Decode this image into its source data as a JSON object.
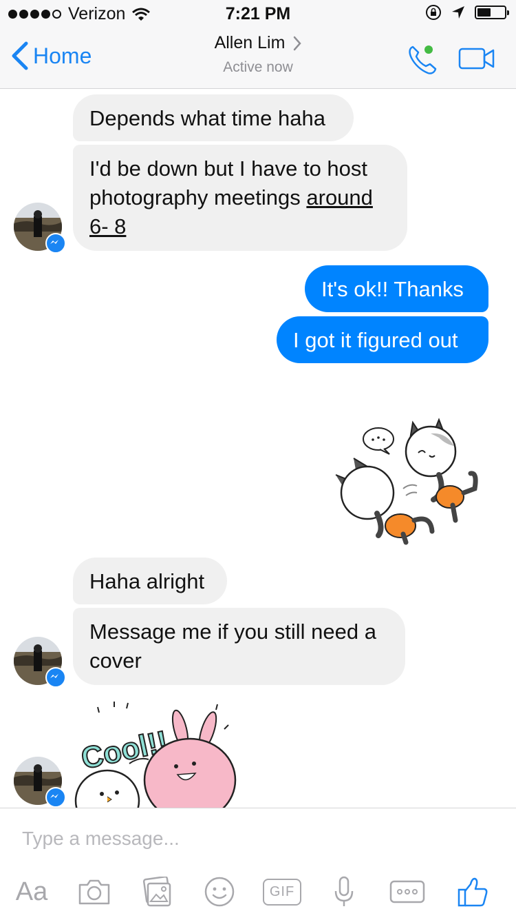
{
  "status_bar": {
    "carrier": "Verizon",
    "time": "7:21 PM",
    "signal_bars_filled": 4,
    "signal_bars_total": 5,
    "battery_level": 0.5,
    "icons": [
      "wifi-icon",
      "orientation-lock-icon",
      "location-arrow-icon",
      "battery-icon"
    ]
  },
  "header": {
    "back_label": "Home",
    "contact_name": "Allen Lim",
    "status": "Active now",
    "icons": [
      "back-chevron-icon",
      "chevron-right-icon",
      "phone-call-icon",
      "video-call-icon"
    ]
  },
  "messages": [
    {
      "direction": "incoming",
      "text": "Depends what time haha"
    },
    {
      "direction": "incoming",
      "parts": [
        "I'd be down but I have to host photography meetings ",
        "around 6- 8"
      ]
    },
    {
      "direction": "outgoing",
      "text": "It's ok!! Thanks"
    },
    {
      "direction": "outgoing",
      "text": "I got it figured out"
    },
    {
      "direction": "outgoing",
      "type": "sticker",
      "sticker": "two-cats-sticker"
    },
    {
      "direction": "incoming",
      "text": "Haha alright"
    },
    {
      "direction": "incoming",
      "text": "Message me if you still need a cover"
    },
    {
      "direction": "incoming",
      "type": "sticker",
      "sticker": "cool-bunny-sticker",
      "sticker_text": "Cool!!"
    }
  ],
  "composer": {
    "placeholder": "Type a message...",
    "toolbar": {
      "text_style_label": "Aa",
      "gif_label": "GIF",
      "icons": [
        "camera-icon",
        "gallery-icon",
        "emoji-icon",
        "gif-icon",
        "microphone-icon",
        "more-icon",
        "thumbs-up-icon"
      ]
    }
  },
  "colors": {
    "accent": "#1a85f3",
    "outgoing_bubble": "#0084ff",
    "incoming_bubble": "#f0f0f0",
    "active_dot": "#44bb44",
    "sticker_orange": "#f58a2a"
  }
}
